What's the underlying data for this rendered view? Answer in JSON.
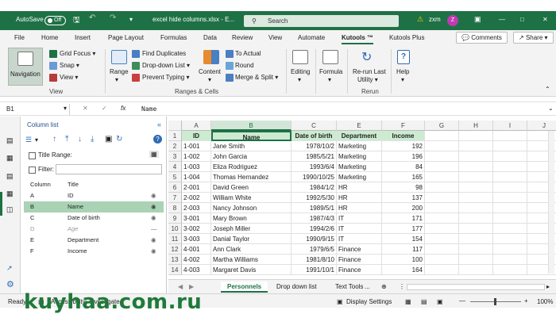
{
  "titlebar": {
    "autosave_label": "AutoSave",
    "autosave_state": "Off",
    "filename": "excel hide columns.xlsx - E...",
    "search_placeholder": "Search",
    "user_name": "zxm",
    "avatar_initial": "Z"
  },
  "menu": {
    "items": [
      "File",
      "Home",
      "Insert",
      "Page Layout",
      "Formulas",
      "Data",
      "Review",
      "View",
      "Automate",
      "Kutools ™",
      "Kutools Plus"
    ],
    "comments_label": "Comments",
    "share_label": "Share"
  },
  "ribbon": {
    "navigation_label": "Navigation",
    "grid_focus_label": "Grid Focus",
    "snap_label": "Snap",
    "view_label": "View",
    "range_label": "Range",
    "find_duplicates_label": "Find Duplicates",
    "dropdown_list_label": "Drop-down List",
    "prevent_typing_label": "Prevent Typing",
    "content_label": "Content",
    "to_actual_label": "To Actual",
    "round_label": "Round",
    "merge_split_label": "Merge & Split",
    "editing_label": "Editing",
    "formula_label": "Formula",
    "rerun_label1": "Re-run Last",
    "rerun_label2": "Utility",
    "help_label": "Help",
    "group_view": "View",
    "group_ranges": "Ranges & Cells",
    "group_rerun": "Rerun"
  },
  "formula_bar": {
    "name_box": "B1",
    "fx": "fx",
    "content": "Name"
  },
  "column_list": {
    "title": "Column list",
    "title_range_label": "Title Range:",
    "filter_label": "Filter:",
    "col_header": "Column",
    "title_header": "Title",
    "rows": [
      {
        "col": "A",
        "title": "ID"
      },
      {
        "col": "B",
        "title": "Name"
      },
      {
        "col": "C",
        "title": "Date of birth"
      },
      {
        "col": "D",
        "title": "Age"
      },
      {
        "col": "E",
        "title": "Department"
      },
      {
        "col": "F",
        "title": "Income"
      }
    ]
  },
  "sheet": {
    "columns": [
      "A",
      "B",
      "C",
      "E",
      "F",
      "G",
      "H",
      "I",
      "J"
    ],
    "headers": [
      "ID",
      "Name",
      "Date of birth",
      "Department",
      "Income"
    ],
    "rows": [
      [
        "1-001",
        "Jane Smith",
        "1978/10/2",
        "Marketing",
        "192"
      ],
      [
        "1-002",
        "John Garcia",
        "1985/5/21",
        "Marketing",
        "196"
      ],
      [
        "1-003",
        "Eliza Rodriguez",
        "1993/6/4",
        "Marketing",
        "84"
      ],
      [
        "1-004",
        "Thomas Hernandez",
        "1990/10/25",
        "Marketing",
        "165"
      ],
      [
        "2-001",
        "David Green",
        "1984/1/2",
        "HR",
        "98"
      ],
      [
        "2-002",
        "William White",
        "1992/5/30",
        "HR",
        "137"
      ],
      [
        "2-003",
        "Nancy Johnson",
        "1989/5/1",
        "HR",
        "200"
      ],
      [
        "3-001",
        "Mary Brown",
        "1987/4/3",
        "IT",
        "171"
      ],
      [
        "3-002",
        "Joseph Miller",
        "1994/2/6",
        "IT",
        "177"
      ],
      [
        "3-003",
        "Danial Taylor",
        "1990/9/15",
        "IT",
        "154"
      ],
      [
        "4-001",
        "Ann Clark",
        "1979/6/5",
        "Finance",
        "117"
      ],
      [
        "4-002",
        "Martha Williams",
        "1981/8/10",
        "Finance",
        "100"
      ],
      [
        "4-003",
        "Margaret Davis",
        "1991/10/1",
        "Finance",
        "164"
      ]
    ],
    "row_numbers": [
      "1",
      "2",
      "3",
      "4",
      "5",
      "6",
      "7",
      "8",
      "9",
      "10",
      "11",
      "12",
      "13",
      "14"
    ]
  },
  "tabs": {
    "items": [
      "Personnels",
      "Drop down list",
      "Text Tools"
    ],
    "more": "..."
  },
  "status": {
    "ready": "Ready",
    "accessibility": "Accessibility: Investigate",
    "display_settings": "Display Settings",
    "zoom": "100%"
  },
  "watermark": "kuyhaa.com.ru",
  "colors": {
    "brand_green": "#1e7145",
    "header_fill": "#ccebd0",
    "watermark": "#1f7a3a"
  }
}
